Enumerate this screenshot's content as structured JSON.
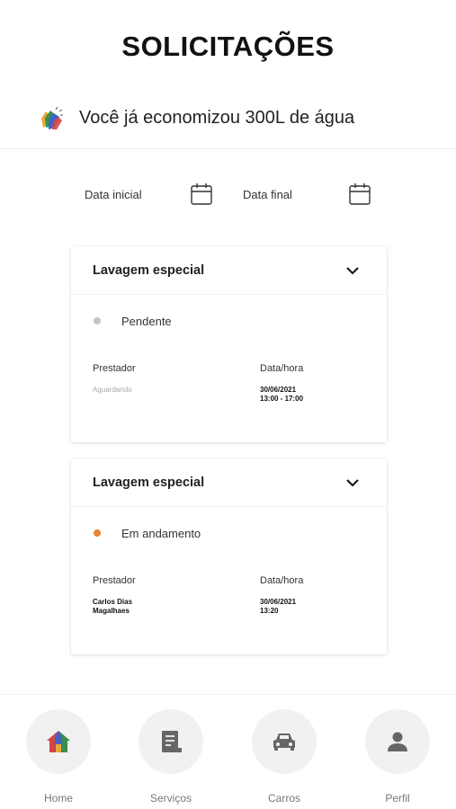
{
  "page": {
    "title": "SOLICITAÇÕES"
  },
  "savings": {
    "text": "Você já economizou 300L de água",
    "icon": "clapping-hands-icon"
  },
  "filters": {
    "start_label": "Data inicial",
    "end_label": "Data final",
    "icon": "calendar-icon"
  },
  "requests": [
    {
      "title": "Lavagem especial",
      "status": "Pendente",
      "status_color": "#c4c4c4",
      "provider_label": "Prestador",
      "provider_line1": "Aguardando",
      "provider_line2": "",
      "datetime_label": "Data/hora",
      "date": "30/06/2021",
      "time": "13:00 - 17:00"
    },
    {
      "title": "Lavagem especial",
      "status": "Em andamento",
      "status_color": "#e8852d",
      "provider_label": "Prestador",
      "provider_line1": "Carlos Dias",
      "provider_line2": "Magalhaes",
      "datetime_label": "Data/hora",
      "date": "30/06/2021",
      "time": "13:20"
    }
  ],
  "nav": {
    "items": [
      {
        "label": "Home",
        "icon": "home-icon"
      },
      {
        "label": "Serviços",
        "icon": "receipt-icon"
      },
      {
        "label": "Carros",
        "icon": "car-icon"
      },
      {
        "label": "Perfil",
        "icon": "person-icon"
      }
    ]
  },
  "colors": {
    "accent_orange": "#e8852d",
    "nav_circle": "#f1f1f1",
    "icon_gray": "#666666"
  }
}
